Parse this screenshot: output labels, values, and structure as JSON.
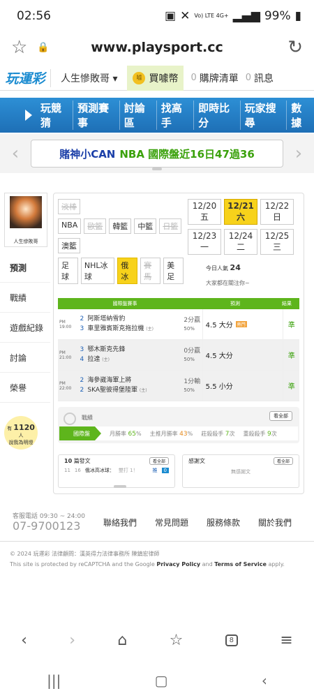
{
  "status": {
    "time": "02:56",
    "signal": "Vo) LTE 4G+",
    "battery": "99%"
  },
  "browser": {
    "url": "www.playsport.cc"
  },
  "nav": {
    "logo": "玩運彩",
    "user": "人生慘敗哥 ▾",
    "buy": "買噱幣",
    "buy_coin": "噱",
    "count1": "0",
    "list": "購牌清單",
    "count2": "0",
    "msg": "訊息"
  },
  "banner": {
    "items": [
      "玩競猜",
      "預測賽事",
      "討論區",
      "找高手",
      "即時比分",
      "玩家搜尋",
      "數據"
    ]
  },
  "ticker": {
    "text": "賭神小CAN",
    "highlight": "NBA 國際盤近16日47過36"
  },
  "sidebar": {
    "avatar_name": "人生慘敗哥",
    "menu": [
      "預測",
      "戰績",
      "遊戲紀錄",
      "討論",
      "榮譽"
    ],
    "fans_prefix": "有",
    "fans_count": "1120",
    "fans_suffix": "人",
    "fans_text": "說我為明燈"
  },
  "filters": {
    "rows": [
      [
        {
          "label": "淡棒",
          "state": "off"
        }
      ],
      [
        {
          "label": "NBA",
          "state": ""
        },
        {
          "label": "歐籃",
          "state": "off"
        },
        {
          "label": "韓籃",
          "state": ""
        },
        {
          "label": "中籃",
          "state": ""
        },
        {
          "label": "日籃",
          "state": "off"
        }
      ],
      [
        {
          "label": "澳籃",
          "state": ""
        }
      ],
      [
        {
          "label": "足球",
          "state": ""
        },
        {
          "label": "NHL冰球",
          "state": ""
        },
        {
          "label": "俄冰",
          "state": "on"
        },
        {
          "label": "賽馬",
          "state": "off"
        },
        {
          "label": "美足",
          "state": ""
        }
      ]
    ]
  },
  "dates": {
    "rows": [
      [
        {
          "d": "12/20",
          "w": "五",
          "sel": false
        },
        {
          "d": "12/21",
          "w": "六",
          "sel": true
        },
        {
          "d": "12/22",
          "w": "日",
          "sel": false
        }
      ],
      [
        {
          "d": "12/23",
          "w": "一",
          "sel": false
        },
        {
          "d": "12/24",
          "w": "二",
          "sel": false
        },
        {
          "d": "12/25",
          "w": "三",
          "sel": false
        }
      ]
    ]
  },
  "popularity": {
    "label": "今日人氣",
    "value": "24",
    "sub": "大家都在關注你~"
  },
  "games": {
    "headers": [
      "國際盤賽事",
      "預測",
      "結果"
    ],
    "rows": [
      {
        "time": "PM 19:00",
        "n1": "2",
        "t1": "阿斯塔納雪豹",
        "n2": "3",
        "t2": "車里雅賓斯克拖拉機",
        "s": "(主)",
        "odd": "2分贏",
        "odd2": "50%",
        "pick": "4.5 大分",
        "hot": "熱門",
        "result": "準"
      },
      {
        "time": "PM 21:00",
        "n1": "3",
        "t1": "鄂木斯克先鋒",
        "n2": "4",
        "t2": "拉達",
        "s": "(主)",
        "odd": "0分贏",
        "odd2": "50%",
        "pick": "4.5 大分",
        "hot": "",
        "result": "準"
      },
      {
        "time": "PM 22:00",
        "n1": "2",
        "t1": "海參崴海軍上將",
        "n2": "2",
        "t2": "SKA聖彼得堡陸軍",
        "s": "(主)",
        "odd": "1分輸",
        "odd2": "50%",
        "pick": "5.5 小分",
        "hot": "",
        "result": "準"
      }
    ]
  },
  "stats": {
    "label": "戰績",
    "all": "看全部",
    "tab": "國際盤",
    "month_win_label": "月勝率",
    "month_win": "65",
    "home_month_label": "主推月勝率",
    "home_month": "43",
    "banker_label": "莊殺殺手",
    "banker": "7",
    "big_label": "重殺殺手",
    "big": "9",
    "pct": "%",
    "times": "次"
  },
  "panels": {
    "left_title_n": "10",
    "left_title": "篇發文",
    "left_btn": "看全部",
    "left_post_d1": "11",
    "left_post_d2": "16",
    "left_post": "俄冰高冰球：",
    "left_post_sub": "雙打 1！",
    "left_post_tag": "推",
    "left_post_n": "0",
    "right_title": "感謝文",
    "right_btn": "看全部",
    "right_empty": "無感謝文"
  },
  "footer": {
    "svc": "客服電話 09:30 ~ 24:00",
    "phone": "07-9700123",
    "links": [
      "聯絡我們",
      "常見問題",
      "服務條款",
      "關於我們"
    ],
    "copy": "© 2024 玩運彩 法律顧問：漢英得力法律事務所 陳鎮宏律師",
    "recap1": "This site is protected by reCAPTCHA and the Google ",
    "recap_pp": "Privacy Policy",
    "recap_and": " and ",
    "recap_tos": "Terms of Service",
    "recap_end": " apply."
  }
}
